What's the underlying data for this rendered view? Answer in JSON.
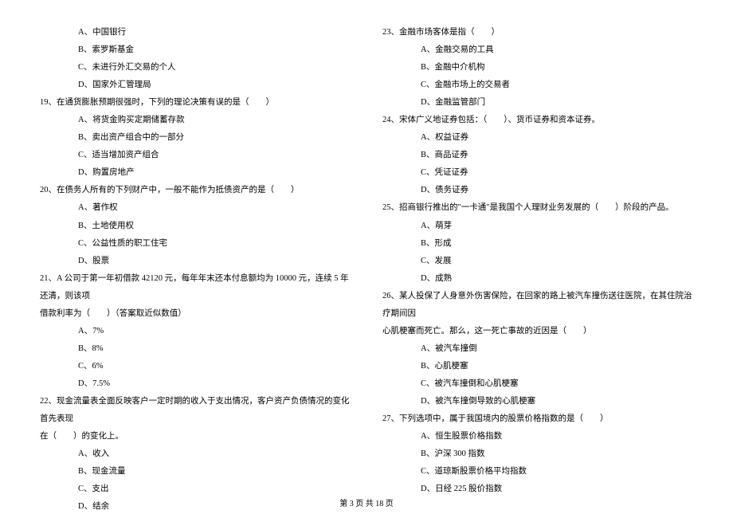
{
  "leftColumn": {
    "preOptions": [
      "A、中国银行",
      "B、索罗斯基金",
      "C、未进行外汇交易的个人",
      "D、国家外汇管理局"
    ],
    "q19": {
      "text": "19、在通货膨胀预期很强时，下列的理论决策有误的是（　　）",
      "options": [
        "A、将货金购买定期储蓄存款",
        "B、卖出资产组合中的一部分",
        "C、适当增加资产组合",
        "D、购置房地产"
      ]
    },
    "q20": {
      "text": "20、在债务人所有的下列财产中，一般不能作为抵债资产的是（　　）",
      "options": [
        "A、著作权",
        "B、土地使用权",
        "C、公益性质的职工住宅",
        "D、股票"
      ]
    },
    "q21": {
      "line1": "21、A 公司于第一年初借款 42120 元，每年年末还本付息额均为 10000 元，连续 5 年还清，则该项",
      "line2": "借款利率为（　　）（答案取近似数值）",
      "options": [
        "A、7%",
        "B、8%",
        "C、6%",
        "D、7.5%"
      ]
    },
    "q22": {
      "line1": "22、现金流量表全面反映客户一定时期的收入于支出情况，客户资产负债情况的变化首先表现",
      "line2": "在（　　）的变化上。",
      "options": [
        "A、收入",
        "B、现金流量",
        "C、支出",
        "D、结余"
      ]
    }
  },
  "rightColumn": {
    "q23": {
      "text": "23、金融市场客体是指（　　）",
      "options": [
        "A、金融交易的工具",
        "B、金融中介机构",
        "C、金融市场上的交易者",
        "D、金融监管部门"
      ]
    },
    "q24": {
      "text": "24、宋体广义地证券包括：（　　）、货币证券和资本证券。",
      "options": [
        "A、权益证券",
        "B、商品证券",
        "C、凭证证券",
        "D、债务证券"
      ]
    },
    "q25": {
      "text": "25、招商银行推出的\"一卡通\"是我国个人理财业务发展的（　　）阶段的产品。",
      "options": [
        "A、萌芽",
        "B、形成",
        "C、发展",
        "D、成熟"
      ]
    },
    "q26": {
      "line1": "26、某人投保了人身意外伤害保险，在回家的路上被汽车撞伤送往医院，在其住院治疗期间因",
      "line2": "心肌梗塞而死亡。那么，这一死亡事故的近因是（　　）",
      "options": [
        "A、被汽车撞倒",
        "B、心肌梗塞",
        "C、被汽车撞倒和心肌梗塞",
        "D、被汽车撞倒导致的心肌梗塞"
      ]
    },
    "q27": {
      "text": "27、下列选项中，属于我国境内的股票价格指数的是（　　）",
      "options": [
        "A、恒生股票价格指数",
        "B、沪深 300 指数",
        "C、道琼斯股票价格平均指数",
        "D、日经 225 股价指数"
      ]
    }
  },
  "footer": "第 3 页 共 18 页"
}
